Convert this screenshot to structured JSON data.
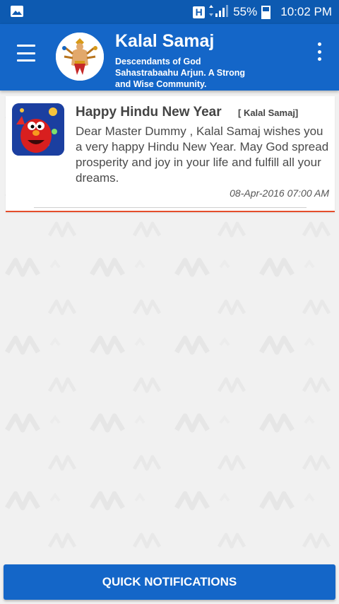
{
  "status_bar": {
    "network_badge": "H",
    "battery": "55%",
    "time": "10:02 PM"
  },
  "app_bar": {
    "title": "Kalal Samaj",
    "subtitle": "Descendants of God Sahastrabaahu Arjun. A Strong and Wise Community."
  },
  "notifications": [
    {
      "title": "Happy Hindu New Year",
      "tag": "[ Kalal Samaj]",
      "body": "Dear Master Dummy , Kalal Samaj wishes you a very happy Hindu New Year. May God spread prosperity and joy in your life and fulfill all your dreams.",
      "date": "08-Apr-2016 07:00 AM"
    }
  ],
  "bottom_button": {
    "label": "QUICK NOTIFICATIONS"
  },
  "colors": {
    "primary": "#1466c8",
    "status_bar": "#0d5ab1",
    "card_accent": "#e44d2b",
    "background": "#f1f1f1"
  },
  "icons": [
    "gallery-icon",
    "signal-icon",
    "battery-icon",
    "menu-icon",
    "overflow-menu-icon"
  ]
}
